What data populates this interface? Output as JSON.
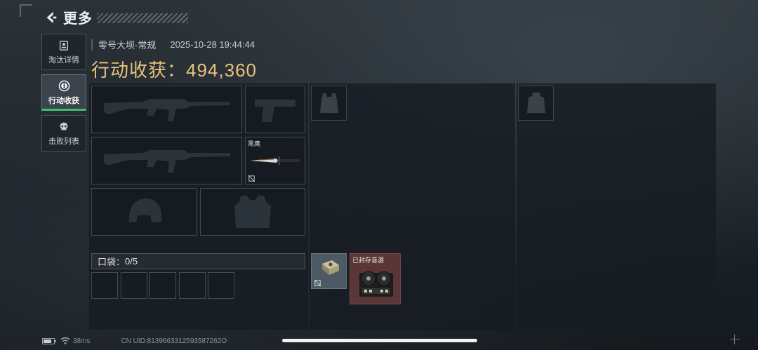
{
  "header": {
    "title": "更多",
    "back_icon": "back-arrow-icon"
  },
  "sidebar": {
    "items": [
      {
        "label": "淘汰详情",
        "icon": "id-badge-icon",
        "active": false
      },
      {
        "label": "行动收获",
        "icon": "coin-icon",
        "active": true
      },
      {
        "label": "击败列表",
        "icon": "skull-icon",
        "active": false
      }
    ]
  },
  "match": {
    "map_mode": "零号大坝-常规",
    "datetime": "2025-10-28 19:44:44",
    "harvest_label": "行动收获：",
    "harvest_value": "494,360"
  },
  "loadout": {
    "primary_weapon_icon": "rifle-silhouette-icon",
    "secondary_weapon_icon": "rifle-silhouette-icon",
    "pistol_icon": "pistol-silhouette-icon",
    "melee": {
      "name": "黑鹰",
      "icon": "knife-icon",
      "locked_icon": "no-insure-icon"
    },
    "helmet_icon": "helmet-silhouette-icon",
    "armor_icon": "armor-silhouette-icon",
    "chest_rig_icon": "chest-rig-icon",
    "backpack_icon": "backpack-icon"
  },
  "pocket": {
    "label": "口袋：",
    "count": "0/5",
    "slots": 5
  },
  "loot": [
    {
      "name": "",
      "icon": "device-case-icon",
      "rarity_color": "#4d5a63",
      "locked_icon": "no-insure-icon"
    },
    {
      "name": "已封存音源",
      "icon": "tape-recorder-icon",
      "rarity_color": "#5a3636"
    }
  ],
  "status": {
    "ping": "38ms",
    "uid": "CN UID:8139663312593587262O"
  },
  "colors": {
    "accent_green": "#3fbf6d",
    "harvest_gold": "#e8c47a"
  }
}
